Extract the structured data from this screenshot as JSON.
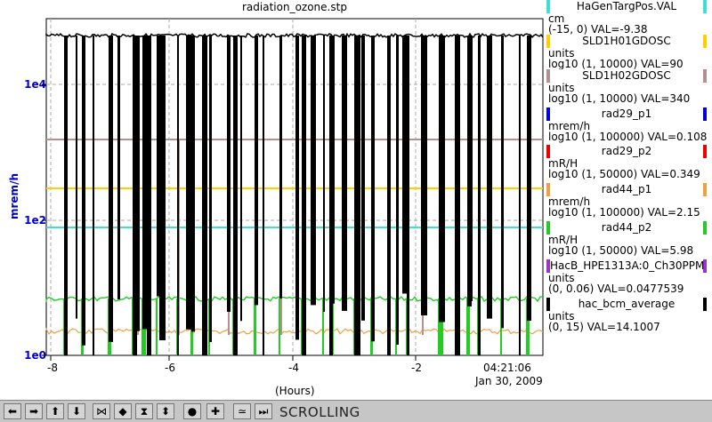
{
  "window": {
    "title": "radiation_ozone.stp"
  },
  "plot": {
    "y_axis_label": "mrem/h",
    "y_ticks": [
      "1e4",
      "1e2",
      "1e0"
    ],
    "x_ticks": [
      "-8",
      "-6",
      "-4",
      "-2"
    ],
    "x_axis_label": "(Hours)",
    "end_time": "04:21:06",
    "end_date": "Jan 30, 2009",
    "colors": {
      "black": "#000000",
      "rosybrown": "#b49090",
      "gold": "#ffd000",
      "turquoise": "#40e0d0",
      "green": "#22cc22",
      "orange": "#f0a040",
      "grid": "#aaaaaa"
    }
  },
  "legend": [
    {
      "name": "HaGenTargPos.VAL",
      "units": "cm",
      "range": "(-15, 0) VAL=-9.38",
      "color": "#40e0d0"
    },
    {
      "name": "SLD1H01GDOSC",
      "units": "units",
      "range": "log10 (1, 10000) VAL=90",
      "color": "#ffd000"
    },
    {
      "name": "SLD1H02GDOSC",
      "units": "units",
      "range": "log10 (1, 10000) VAL=340",
      "color": "#b49090"
    },
    {
      "name": "rad29_p1",
      "units": "mrem/h",
      "range": "log10 (1, 100000) VAL=0.108",
      "color": "#0000dd"
    },
    {
      "name": "rad29_p2",
      "units": "mR/H",
      "range": "log10 (1, 50000) VAL=0.349",
      "color": "#ee0000"
    },
    {
      "name": "rad44_p1",
      "units": "mrem/h",
      "range": "log10 (1, 100000) VAL=2.15",
      "color": "#f0a040"
    },
    {
      "name": "rad44_p2",
      "units": "mR/H",
      "range": "log10 (1, 50000) VAL=5.98",
      "color": "#22cc22"
    },
    {
      "name": "HacB_HPE1313A:0_Ch30PPM",
      "units": "units",
      "range": "(0, 0.06) VAL=0.0477539",
      "color": "#9933cc"
    },
    {
      "name": "hac_bcm_average",
      "units": "units",
      "range": "(0, 15) VAL=14.1007",
      "color": "#000000"
    }
  ],
  "toolbar": {
    "status": "SCROLLING",
    "buttons": [
      {
        "name": "scroll-left-icon",
        "glyph": "➡"
      },
      {
        "name": "scroll-right-icon",
        "glyph": "➡"
      },
      {
        "name": "scroll-up-icon",
        "glyph": "⬆"
      },
      {
        "name": "scroll-down-icon",
        "glyph": "⬇"
      },
      {
        "name": "compress-horizontal-icon",
        "glyph": "⋈"
      },
      {
        "name": "expand-horizontal-icon",
        "glyph": "◆"
      },
      {
        "name": "compress-vertical-icon",
        "glyph": "⧗"
      },
      {
        "name": "expand-vertical-icon",
        "glyph": "⬍"
      },
      {
        "name": "record-icon",
        "glyph": "●"
      },
      {
        "name": "add-icon",
        "glyph": "✚"
      },
      {
        "name": "autoscale-icon",
        "glyph": "≃"
      },
      {
        "name": "go-to-end-icon",
        "glyph": "⏭"
      }
    ]
  }
}
